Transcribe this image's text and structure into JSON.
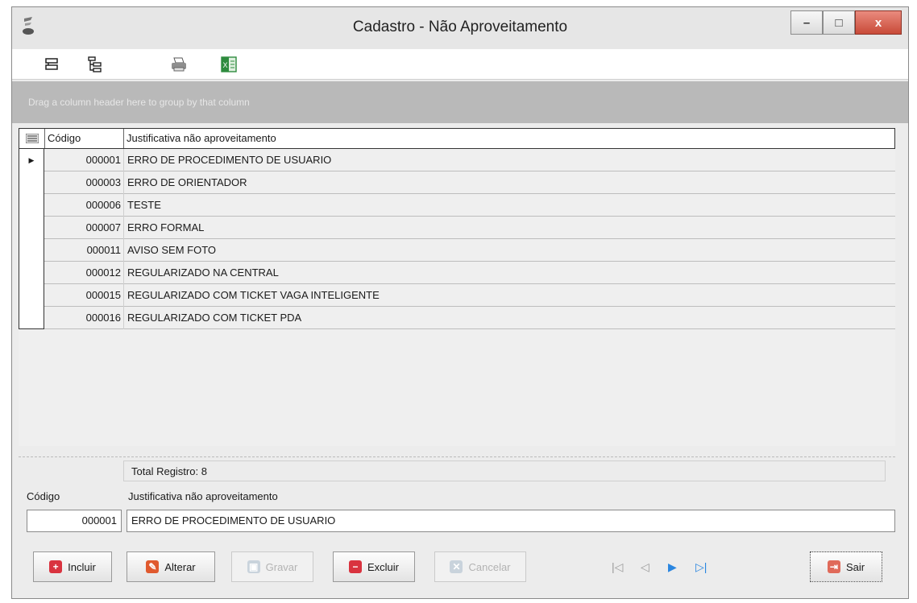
{
  "window": {
    "title": "Cadastro - Não Aproveitamento",
    "minimize_glyph": "–",
    "maximize_glyph": "□",
    "close_glyph": "x"
  },
  "toolbar": {
    "icons": [
      "group-rows-icon",
      "tree-view-icon",
      "print-icon",
      "excel-export-icon"
    ]
  },
  "group_panel": {
    "hint": "Drag a column header here to group by that column"
  },
  "grid": {
    "columns": {
      "code": "Código",
      "justification": "Justificativa não aproveitamento"
    },
    "rows": [
      {
        "code": "000001",
        "justification": "ERRO DE PROCEDIMENTO DE USUARIO",
        "selected": true
      },
      {
        "code": "000003",
        "justification": "ERRO DE ORIENTADOR"
      },
      {
        "code": "000006",
        "justification": "TESTE"
      },
      {
        "code": "000007",
        "justification": "ERRO FORMAL"
      },
      {
        "code": "000011",
        "justification": "AVISO SEM FOTO"
      },
      {
        "code": "000012",
        "justification": "REGULARIZADO NA CENTRAL"
      },
      {
        "code": "000015",
        "justification": "REGULARIZADO COM TICKET VAGA INTELIGENTE"
      },
      {
        "code": "000016",
        "justification": "REGULARIZADO COM TICKET PDA"
      }
    ],
    "total_label": "Total Registro: 8"
  },
  "form": {
    "code_label": "Código",
    "code_value": "000001",
    "justification_label": "Justificativa não  aproveitamento",
    "justification_value": "ERRO DE PROCEDIMENTO DE USUARIO"
  },
  "buttons": {
    "incluir": "Incluir",
    "alterar": "Alterar",
    "gravar": "Gravar",
    "excluir": "Excluir",
    "cancelar": "Cancelar",
    "sair": "Sair"
  },
  "navigator": {
    "first": "|◁",
    "prev": "◁",
    "next": "▶",
    "last": "▷|"
  },
  "colors": {
    "accent_blue": "#2a86e0",
    "close_red": "#c84a38",
    "excel_green": "#2e8b3e",
    "add_red": "#d9333f"
  }
}
